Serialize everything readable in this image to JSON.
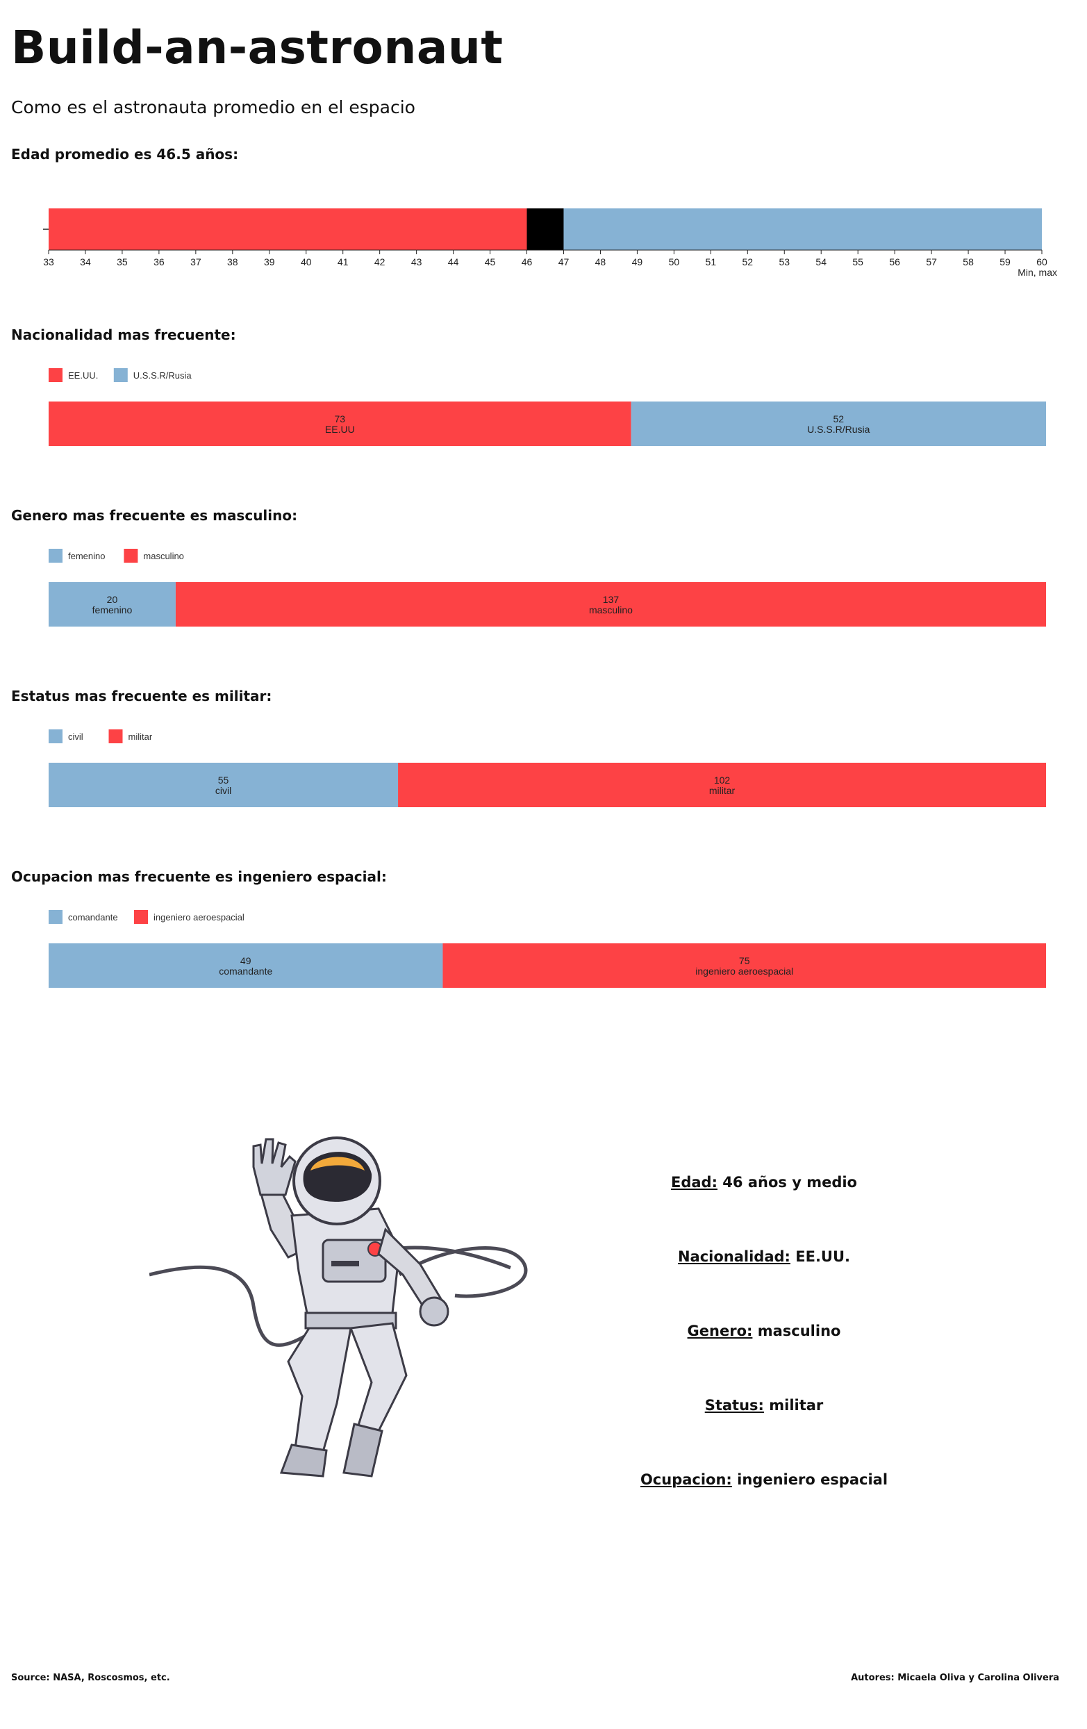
{
  "page": {
    "title": "Build-an-astronaut",
    "subtitle": "Como es el astronauta promedio en el espacio"
  },
  "colors": {
    "red": "#fd4245",
    "blue": "#86b2d4",
    "black": "#000000"
  },
  "chart_data": [
    {
      "type": "bar",
      "orientation": "horizontal-range",
      "title": "Edad promedio es 46.5 años:",
      "xlim": [
        33,
        60
      ],
      "ticks": [
        33,
        34,
        35,
        36,
        37,
        38,
        39,
        40,
        41,
        42,
        43,
        44,
        45,
        46,
        47,
        48,
        49,
        50,
        51,
        52,
        53,
        54,
        55,
        56,
        57,
        58,
        59,
        60
      ],
      "axis_note": "Min, max",
      "segments": [
        {
          "from": 33,
          "to": 46,
          "color": "red"
        },
        {
          "from": 46,
          "to": 47,
          "color": "black"
        },
        {
          "from": 47,
          "to": 60,
          "color": "blue"
        }
      ]
    },
    {
      "type": "bar",
      "orientation": "stacked-horizontal",
      "title": "Nacionalidad mas frecuente:",
      "legend": [
        {
          "name": "EE.UU.",
          "color": "red"
        },
        {
          "name": "U.S.S.R/Rusia",
          "color": "blue"
        }
      ],
      "series": [
        {
          "name": "EE.UU",
          "value": 73,
          "color": "red"
        },
        {
          "name": "U.S.S.R/Rusia",
          "value": 52,
          "color": "blue"
        }
      ]
    },
    {
      "type": "bar",
      "orientation": "stacked-horizontal",
      "title": "Genero mas frecuente es masculino:",
      "legend": [
        {
          "name": "femenino",
          "color": "blue"
        },
        {
          "name": "masculino",
          "color": "red"
        }
      ],
      "series": [
        {
          "name": "femenino",
          "value": 20,
          "color": "blue"
        },
        {
          "name": "masculino",
          "value": 137,
          "color": "red"
        }
      ]
    },
    {
      "type": "bar",
      "orientation": "stacked-horizontal",
      "title": "Estatus mas frecuente es militar:",
      "legend": [
        {
          "name": "civil",
          "color": "blue"
        },
        {
          "name": "militar",
          "color": "red"
        }
      ],
      "series": [
        {
          "name": "civil",
          "value": 55,
          "color": "blue"
        },
        {
          "name": "militar",
          "value": 102,
          "color": "red"
        }
      ]
    },
    {
      "type": "bar",
      "orientation": "stacked-horizontal",
      "title": "Ocupacion mas frecuente es ingeniero espacial:",
      "legend": [
        {
          "name": "comandante",
          "color": "blue"
        },
        {
          "name": "ingeniero aeroespacial",
          "color": "red"
        }
      ],
      "series": [
        {
          "name": "comandante",
          "value": 49,
          "color": "blue"
        },
        {
          "name": "ingeniero aeroespacial",
          "value": 75,
          "color": "red"
        }
      ]
    }
  ],
  "summary": [
    {
      "key": "Edad:",
      "value": "46 años y medio"
    },
    {
      "key": "Nacionalidad:",
      "value": "EE.UU."
    },
    {
      "key": "Genero:",
      "value": "masculino"
    },
    {
      "key": "Status:",
      "value": "militar"
    },
    {
      "key": "Ocupacion:",
      "value": "ingeniero espacial"
    }
  ],
  "illustration": {
    "icon": "astronaut-illustration"
  },
  "footer": {
    "source": "Source: NASA, Roscosmos, etc.",
    "authors": "Autores: Micaela Oliva y Carolina Olivera"
  }
}
